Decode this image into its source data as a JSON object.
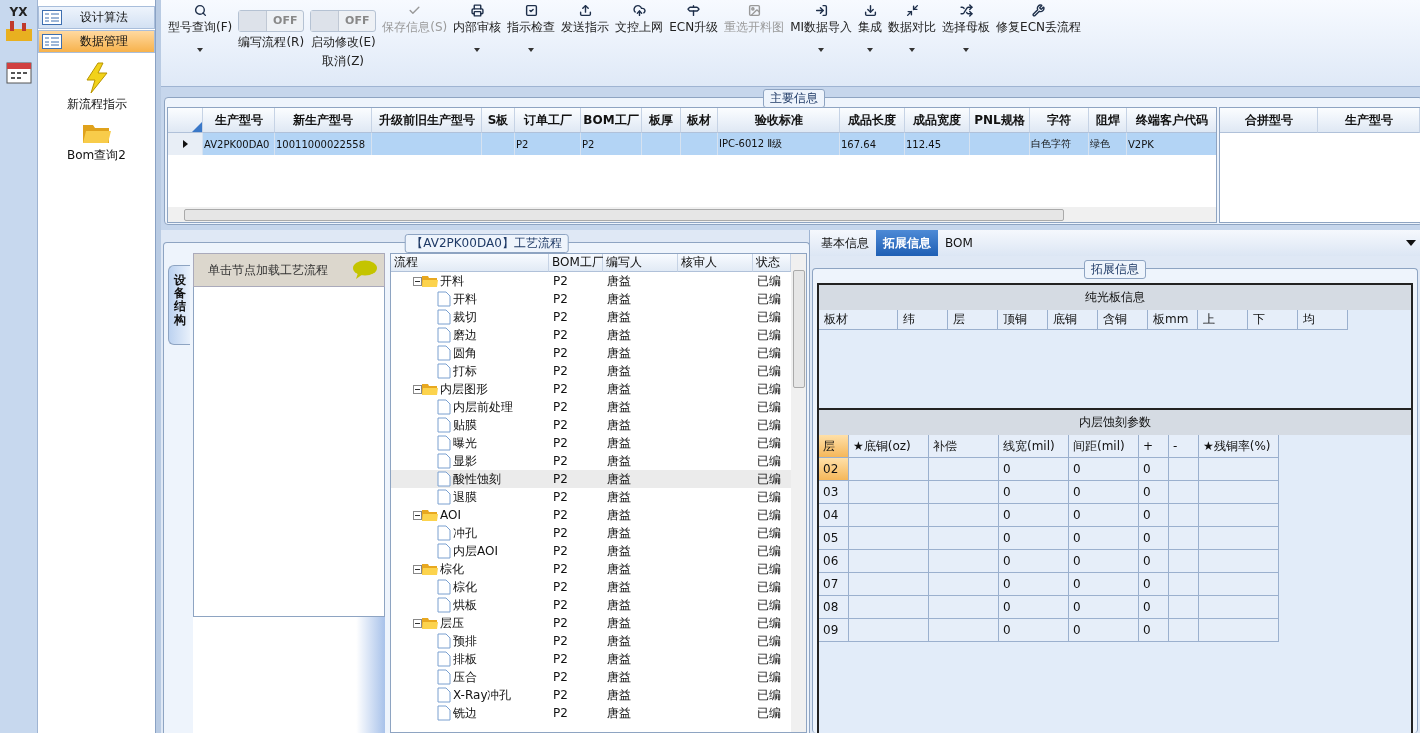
{
  "app": {
    "logo_text": "YX"
  },
  "nav": {
    "items": [
      {
        "label": "设计算法",
        "selected": false
      },
      {
        "label": "数据管理",
        "selected": true
      }
    ],
    "shortcuts": [
      {
        "label": "新流程指示",
        "kind": "bolt"
      },
      {
        "label": "Bom查询2",
        "kind": "folder"
      }
    ]
  },
  "toolbar": [
    {
      "kind": "button",
      "label": "型号查询(F)",
      "dropdown": true,
      "disabled": false
    },
    {
      "kind": "toggle",
      "label": "编写流程(R)",
      "state_text": "OFF",
      "on": false
    },
    {
      "kind": "toggle",
      "label": "启动修改(E)",
      "label2": "取消(Z)",
      "state_text": "OFF",
      "on": false
    },
    {
      "kind": "button",
      "label": "保存信息(S)",
      "dropdown": false,
      "disabled": true
    },
    {
      "kind": "button",
      "label": "内部审核",
      "dropdown": true,
      "disabled": false
    },
    {
      "kind": "button",
      "label": "指示检查",
      "dropdown": true,
      "disabled": false
    },
    {
      "kind": "button",
      "label": "发送指示",
      "dropdown": false,
      "disabled": false
    },
    {
      "kind": "button",
      "label": "文控上网",
      "dropdown": false,
      "disabled": false
    },
    {
      "kind": "button",
      "label": "ECN升级",
      "dropdown": false,
      "disabled": false
    },
    {
      "kind": "button",
      "label": "重选开料图",
      "dropdown": false,
      "disabled": true
    },
    {
      "kind": "button",
      "label": "MI数据导入",
      "dropdown": true,
      "disabled": false
    },
    {
      "kind": "button",
      "label": "集成",
      "dropdown": true,
      "disabled": false
    },
    {
      "kind": "button",
      "label": "数据对比",
      "dropdown": true,
      "disabled": false
    },
    {
      "kind": "button",
      "label": "选择母板",
      "dropdown": true,
      "disabled": false
    },
    {
      "kind": "button",
      "label": "修复ECN丢流程",
      "dropdown": false,
      "disabled": false
    }
  ],
  "main_info": {
    "title": "主要信息",
    "columns": [
      "生产型号",
      "新生产型号",
      "升级前旧生产型号",
      "S板",
      "订单工厂",
      "BOM工厂",
      "板厚",
      "板材",
      "验收标准",
      "成品长度",
      "成品宽度",
      "PNL规格",
      "字符",
      "阻焊",
      "终端客户代码"
    ],
    "rows": [
      {
        "selected": true,
        "cells": [
          "AV2PK00DA0",
          "10011000022558",
          "",
          "",
          "P2",
          "P2",
          "",
          "",
          "IPC-6012 Ⅱ级",
          "167.64",
          "112.45",
          "",
          "白色字符",
          "绿色",
          "V2PK"
        ]
      }
    ],
    "side_columns": [
      "合拼型号",
      "生产型号"
    ]
  },
  "process": {
    "title": "【AV2PK00DA0】工艺流程",
    "side_tab": "设备结构",
    "hint": "单击节点加载工艺流程",
    "columns": [
      "流程",
      "BOM工厂",
      "编写人",
      "核审人",
      "状态"
    ],
    "tree": [
      {
        "name": "开料",
        "bom": "P2",
        "writer": "唐益",
        "status": "已编",
        "expanded": true,
        "selected": false,
        "children": [
          {
            "name": "开料",
            "bom": "P2",
            "writer": "唐益",
            "status": "已编",
            "selected": false
          },
          {
            "name": "裁切",
            "bom": "P2",
            "writer": "唐益",
            "status": "已编",
            "selected": false
          },
          {
            "name": "磨边",
            "bom": "P2",
            "writer": "唐益",
            "status": "已编",
            "selected": false
          },
          {
            "name": "圆角",
            "bom": "P2",
            "writer": "唐益",
            "status": "已编",
            "selected": false
          },
          {
            "name": "打标",
            "bom": "P2",
            "writer": "唐益",
            "status": "已编",
            "selected": false
          }
        ]
      },
      {
        "name": "内层图形",
        "bom": "P2",
        "writer": "唐益",
        "status": "已编",
        "expanded": true,
        "selected": false,
        "children": [
          {
            "name": "内层前处理",
            "bom": "P2",
            "writer": "唐益",
            "status": "已编",
            "selected": false
          },
          {
            "name": "贴膜",
            "bom": "P2",
            "writer": "唐益",
            "status": "已编",
            "selected": false
          },
          {
            "name": "曝光",
            "bom": "P2",
            "writer": "唐益",
            "status": "已编",
            "selected": false
          },
          {
            "name": "显影",
            "bom": "P2",
            "writer": "唐益",
            "status": "已编",
            "selected": false
          },
          {
            "name": "酸性蚀刻",
            "bom": "P2",
            "writer": "唐益",
            "status": "已编",
            "selected": true
          },
          {
            "name": "退膜",
            "bom": "P2",
            "writer": "唐益",
            "status": "已编",
            "selected": false
          }
        ]
      },
      {
        "name": "AOI",
        "bom": "P2",
        "writer": "唐益",
        "status": "已编",
        "expanded": true,
        "selected": false,
        "children": [
          {
            "name": "冲孔",
            "bom": "P2",
            "writer": "唐益",
            "status": "已编",
            "selected": false
          },
          {
            "name": "内层AOI",
            "bom": "P2",
            "writer": "唐益",
            "status": "已编",
            "selected": false
          }
        ]
      },
      {
        "name": "棕化",
        "bom": "P2",
        "writer": "唐益",
        "status": "已编",
        "expanded": true,
        "selected": false,
        "children": [
          {
            "name": "棕化",
            "bom": "P2",
            "writer": "唐益",
            "status": "已编",
            "selected": false
          },
          {
            "name": "烘板",
            "bom": "P2",
            "writer": "唐益",
            "status": "已编",
            "selected": false
          }
        ]
      },
      {
        "name": "层压",
        "bom": "P2",
        "writer": "唐益",
        "status": "已编",
        "expanded": true,
        "selected": false,
        "children": [
          {
            "name": "预排",
            "bom": "P2",
            "writer": "唐益",
            "status": "已编",
            "selected": false
          },
          {
            "name": "排板",
            "bom": "P2",
            "writer": "唐益",
            "status": "已编",
            "selected": false
          },
          {
            "name": "压合",
            "bom": "P2",
            "writer": "唐益",
            "status": "已编",
            "selected": false
          },
          {
            "name": "X-Ray冲孔",
            "bom": "P2",
            "writer": "唐益",
            "status": "已编",
            "selected": false
          },
          {
            "name": "铣边",
            "bom": "P2",
            "writer": "唐益",
            "status": "已编",
            "selected": false
          }
        ]
      }
    ]
  },
  "detail": {
    "tabs": [
      {
        "label": "基本信息",
        "selected": false
      },
      {
        "label": "拓展信息",
        "selected": true
      },
      {
        "label": "BOM",
        "selected": false
      }
    ],
    "title": "拓展信息",
    "bare_board": {
      "title": "纯光板信息",
      "columns": [
        "板材",
        "纬",
        "层",
        "顶铜",
        "底铜",
        "含铜",
        "板mm",
        "上",
        "下",
        "均"
      ]
    },
    "etch": {
      "title": "内层蚀刻参数",
      "columns": [
        "层",
        "★底铜(oz)",
        "补偿",
        "线宽(mil)",
        "间距(mil)",
        "+",
        "-",
        "★残铜率(%)"
      ],
      "rows": [
        {
          "selected": true,
          "cells": [
            "02",
            "",
            "",
            "0",
            "0",
            "0",
            "",
            ""
          ]
        },
        {
          "selected": false,
          "cells": [
            "03",
            "",
            "",
            "0",
            "0",
            "0",
            "",
            ""
          ]
        },
        {
          "selected": false,
          "cells": [
            "04",
            "",
            "",
            "0",
            "0",
            "0",
            "",
            ""
          ]
        },
        {
          "selected": false,
          "cells": [
            "05",
            "",
            "",
            "0",
            "0",
            "0",
            "",
            ""
          ]
        },
        {
          "selected": false,
          "cells": [
            "06",
            "",
            "",
            "0",
            "0",
            "0",
            "",
            ""
          ]
        },
        {
          "selected": false,
          "cells": [
            "07",
            "",
            "",
            "0",
            "0",
            "0",
            "",
            ""
          ]
        },
        {
          "selected": false,
          "cells": [
            "08",
            "",
            "",
            "0",
            "0",
            "0",
            "",
            ""
          ]
        },
        {
          "selected": false,
          "cells": [
            "09",
            "",
            "",
            "0",
            "0",
            "0",
            "",
            ""
          ]
        }
      ]
    }
  }
}
